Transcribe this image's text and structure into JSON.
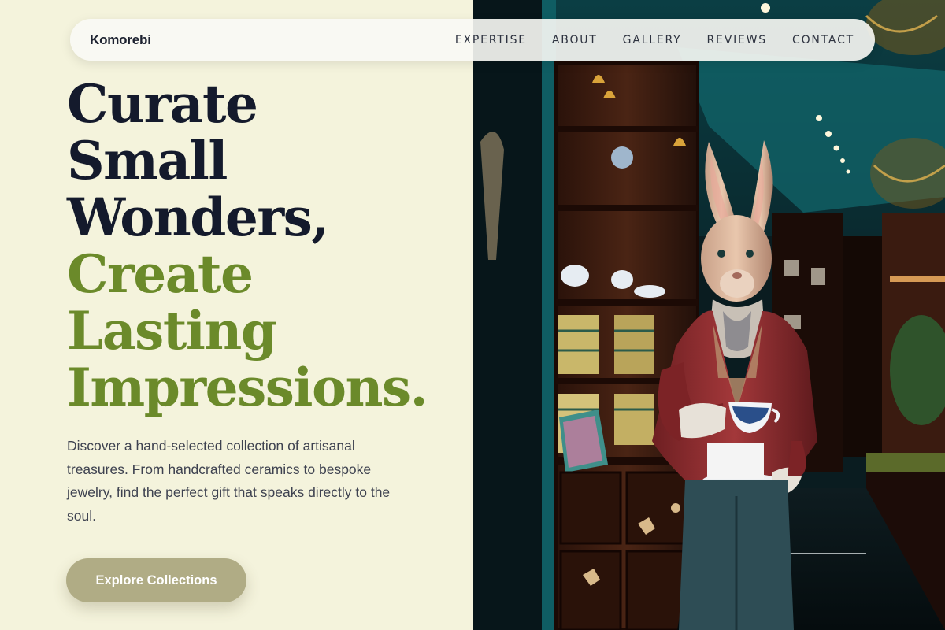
{
  "nav": {
    "brand": "Komorebi",
    "items": [
      {
        "label": "EXPERTISE"
      },
      {
        "label": "ABOUT"
      },
      {
        "label": "GALLERY"
      },
      {
        "label": "REVIEWS"
      },
      {
        "label": "CONTACT"
      }
    ]
  },
  "hero": {
    "headline_dark": [
      "Curate",
      "Small",
      "Wonders,"
    ],
    "headline_green": [
      "Create",
      "Lasting",
      "Impressions."
    ],
    "description": "Discover a hand-selected collection of artisanal treasures. From handcrafted ceramics to bespoke jewelry, find the perfect gift that speaks directly to the soul.",
    "cta_label": "Explore Collections"
  },
  "photo": {
    "subject": "rabbit-figure-in-gift-shop",
    "colors": {
      "teal": "#0f5d63",
      "wood": "#3a1c10",
      "jacket": "#8a2c2c"
    }
  },
  "colors": {
    "background": "#f4f3dc",
    "headline_dark": "#141a2c",
    "headline_green": "#6b8a2a",
    "cta": "#b0ac85"
  }
}
